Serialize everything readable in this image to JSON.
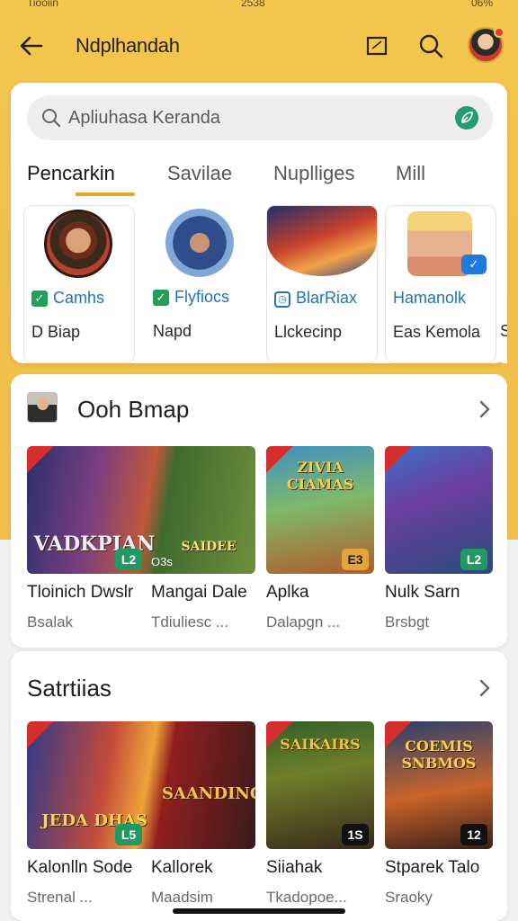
{
  "status_bar": {
    "time": "Tiooiin",
    "center": "2538",
    "right": "06%"
  },
  "app_bar": {
    "title": "Ndplhandah"
  },
  "search": {
    "placeholder": "Apliuhasa Keranda"
  },
  "tabs": [
    {
      "label": "Pencarkin",
      "active": true
    },
    {
      "label": "Savilae",
      "active": false
    },
    {
      "label": "Nuplliges",
      "active": false
    },
    {
      "label": "Mill",
      "active": false
    }
  ],
  "profiles": [
    {
      "tag": "Camhs",
      "name": "D Biap",
      "check": "✓"
    },
    {
      "tag": "Flyfiocs",
      "name": "Napd",
      "check": "✓"
    },
    {
      "tag": "BlarRiax",
      "name": "Llckecinp",
      "check": "◷"
    },
    {
      "tag": "Hamanolk",
      "name": "Eas Kemola",
      "check": ""
    },
    {
      "tag": "",
      "name": "S",
      "check": ""
    }
  ],
  "section1": {
    "title": "Ooh Bmap",
    "games": [
      {
        "title": "Tloinich Dwslr",
        "sub": "Bsalak",
        "art": "VADKPIAN",
        "badge": "L2",
        "mid": "O3s",
        "art2": "SAIDEE"
      },
      {
        "title": "Mangai Dale",
        "sub": "Tdiuliesc ...",
        "art": "",
        "badge": "",
        "mid": "",
        "art2": ""
      },
      {
        "title": "Aplka",
        "sub": "Dalapgn ...",
        "art": "ZIVIA CIAMAS",
        "badge": "E3",
        "mid": "",
        "art2": ""
      },
      {
        "title": "Nulk Sarn",
        "sub": "Brsbgt",
        "art": "",
        "badge": "L2",
        "mid": "",
        "art2": ""
      }
    ]
  },
  "section2": {
    "title": "Satrtiias",
    "games": [
      {
        "title": "Kalonlln Sode",
        "sub": "Strenal ...",
        "art": "JEDA DHAS",
        "badge": "L5",
        "art2": "SAANDING"
      },
      {
        "title": "Kallorek",
        "sub": "Maadsim",
        "art": "",
        "badge": "",
        "art2": ""
      },
      {
        "title": "Siiahak",
        "sub": "Tkadopoe...",
        "art": "SAIKAIRS",
        "badge": "1S",
        "art2": ""
      },
      {
        "title": "Stparek Talo",
        "sub": "Sraoky",
        "art": "COEMIS SNBMOS",
        "badge": "12",
        "art2": ""
      }
    ]
  },
  "colors": {
    "accent": "#f3c74e",
    "underline": "#e2a422",
    "tag_blue": "#1f74b8",
    "check_green": "#22a05a"
  }
}
